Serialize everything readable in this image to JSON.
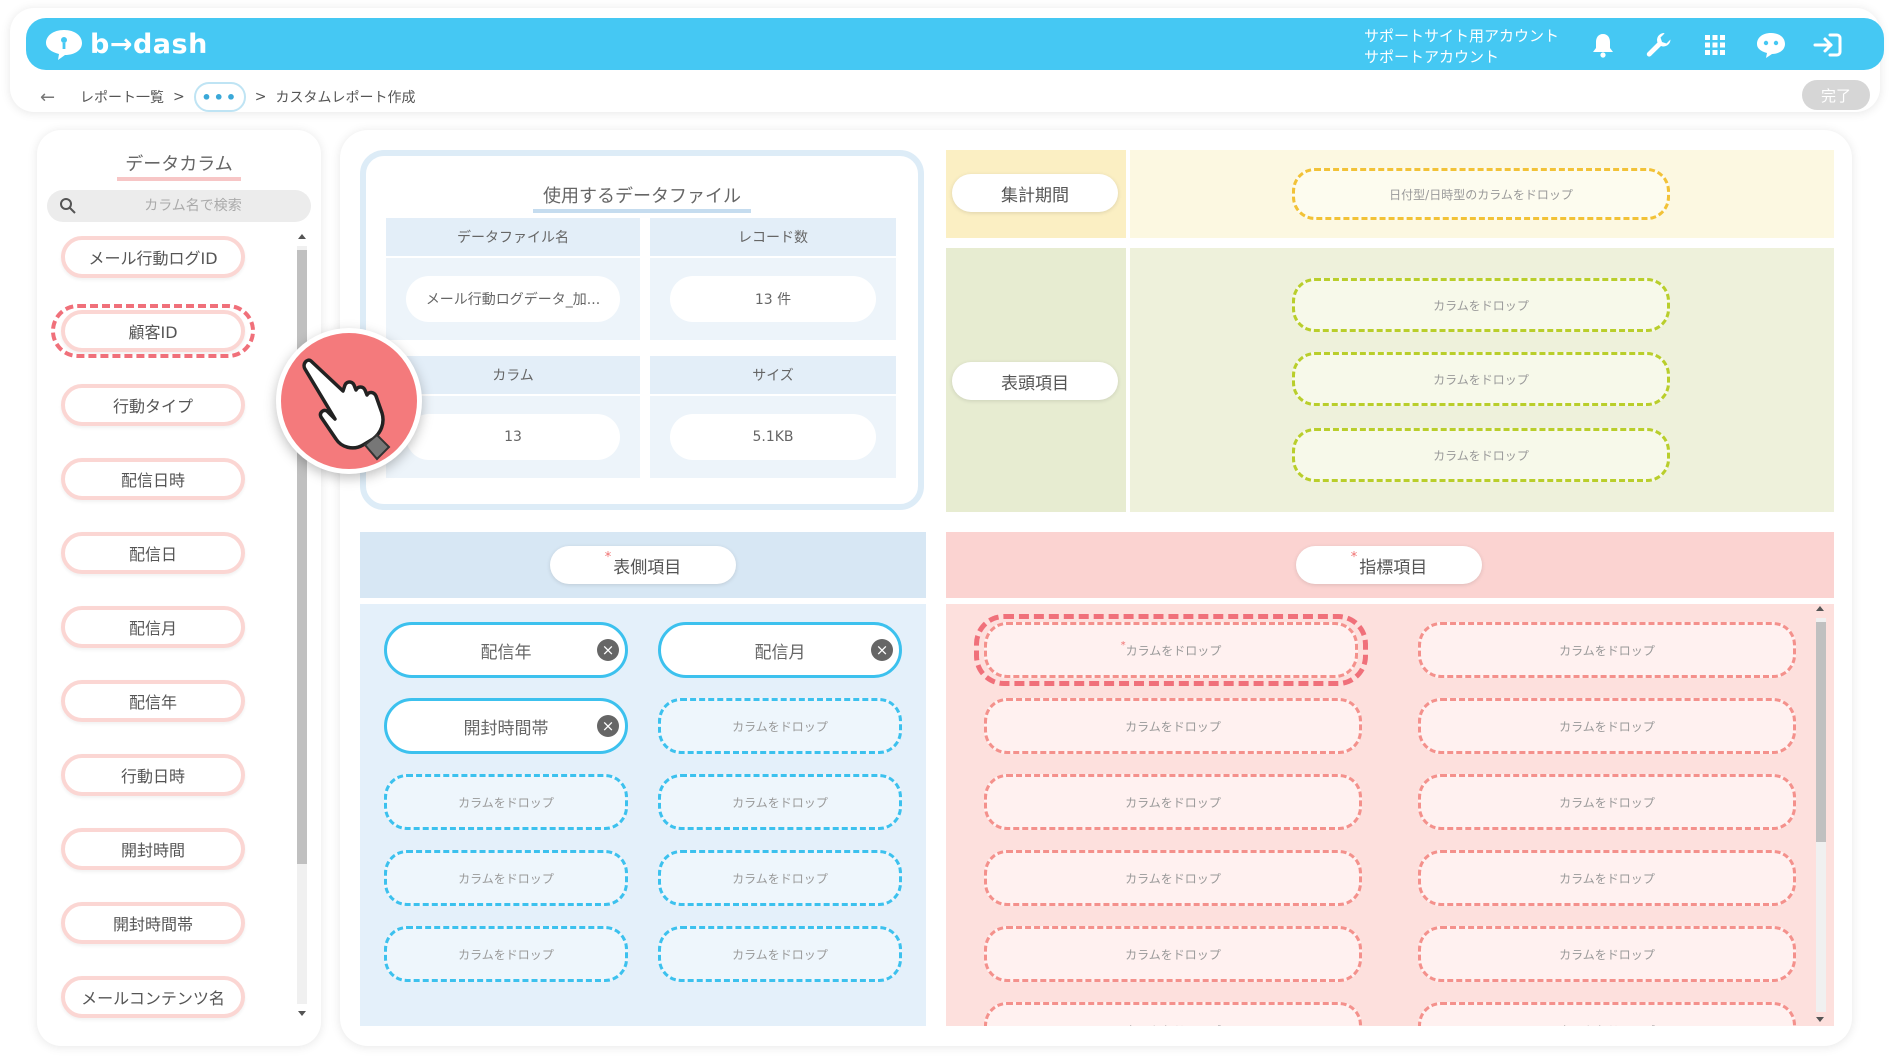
{
  "header": {
    "logo_text": "b→dash",
    "account_line1": "サポートサイト用アカウント",
    "account_line2": "サポートアカウント",
    "icons": [
      "bell-icon",
      "wrench-icon",
      "grid-icon",
      "chat-bot-icon",
      "logout-icon"
    ],
    "bar_color": "#45c8f3"
  },
  "breadcrumb": {
    "back_icon": "arrow-left-icon",
    "report_list": "レポート一覧",
    "separator": ">",
    "ellipsis": "•••",
    "current": "カスタムレポート作成"
  },
  "done_button": "完了",
  "sidebar": {
    "title": "データカラム",
    "search_placeholder": "カラム名で検索",
    "columns": [
      "メール行動ログID",
      "顧客ID",
      "行動タイプ",
      "配信日時",
      "配信日",
      "配信月",
      "配信年",
      "行動日時",
      "開封時間",
      "開封時間帯",
      "メールコンテンツ名"
    ],
    "highlighted_index": 1
  },
  "datafile": {
    "title": "使用するデータファイル",
    "file_name_header": "データファイル名",
    "file_name_value": "メール行動ログデータ_加...",
    "record_count_header": "レコード数",
    "record_count_value": "13 件",
    "column_header": "カラム",
    "column_value": "13",
    "size_header": "サイズ",
    "size_value": "5.1KB"
  },
  "period": {
    "label": "集計期間",
    "drop_text": "日付型/日時型のカラムをドロップ",
    "color": "#fcf8e1"
  },
  "header_items": {
    "label": "表頭項目",
    "drop_text": "カラムをドロップ",
    "slots": 3,
    "color": "#eef1db"
  },
  "row_items": {
    "label": "表側項目",
    "required_mark": "*",
    "filled": [
      "配信年",
      "配信月",
      "開封時間帯"
    ],
    "drop_text": "カラムをドロップ",
    "color": "#e4f0fa"
  },
  "metric_items": {
    "label": "指標項目",
    "required_mark": "*",
    "drop_text": "カラムをドロップ",
    "color": "#fde0dd"
  }
}
